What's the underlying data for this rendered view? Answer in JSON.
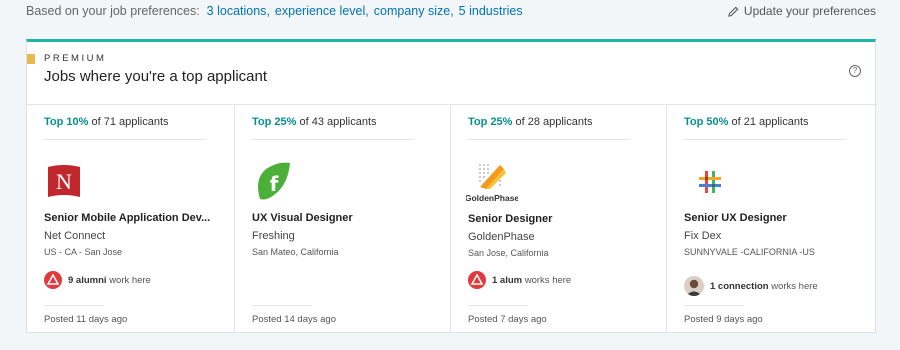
{
  "prefs": {
    "label": "Based on your job preferences:",
    "links": [
      "3 locations",
      "experience level",
      "company size",
      "5 industries"
    ],
    "update_label": "Update your preferences"
  },
  "card": {
    "premium_label": "PREMIUM",
    "title": "Jobs where you're a top applicant",
    "help_glyph": "?"
  },
  "jobs": [
    {
      "rank_pct": "Top 10%",
      "rank_rest": "of 71 applicants",
      "title": "Senior Mobile Application Dev...",
      "company": "Net Connect",
      "location": "US - CA - San Jose",
      "insight_bold": "9 alumni",
      "insight_rest": "work here",
      "insight_icon": "alumni-icon",
      "posted": "Posted 11 days ago",
      "logo": "net-connect-logo",
      "logo_text": "N"
    },
    {
      "rank_pct": "Top 25%",
      "rank_rest": "of 43 applicants",
      "title": "UX Visual Designer",
      "company": "Freshing",
      "location": "San Mateo, California",
      "posted": "Posted 14 days ago",
      "logo": "freshing-logo",
      "logo_text": "f"
    },
    {
      "rank_pct": "Top 25%",
      "rank_rest": "of 28 applicants",
      "title": "Senior Designer",
      "company": "GoldenPhase",
      "location": "San Jose, California",
      "insight_bold": "1 alum",
      "insight_rest": "works here",
      "insight_icon": "alumni-icon",
      "posted": "Posted 7 days ago",
      "logo": "goldenphase-logo",
      "logo_text": "GoldenPhase"
    },
    {
      "rank_pct": "Top 50%",
      "rank_rest": "of 21 applicants",
      "title": "Senior UX Designer",
      "company": "Fix Dex",
      "location": "SUNNYVALE -CALIFORNIA -US",
      "insight_bold": "1 connection",
      "insight_rest": "works here",
      "insight_icon": "connection-avatar",
      "posted": "Posted 9 days ago",
      "logo": "fix-dex-logo"
    }
  ],
  "colors": {
    "link": "#0073b1",
    "accent_teal": "#1fb5a8",
    "rank_teal": "#0a8f8f",
    "premium_gold": "#e8b94c",
    "alumni_red": "#e03a3e"
  }
}
